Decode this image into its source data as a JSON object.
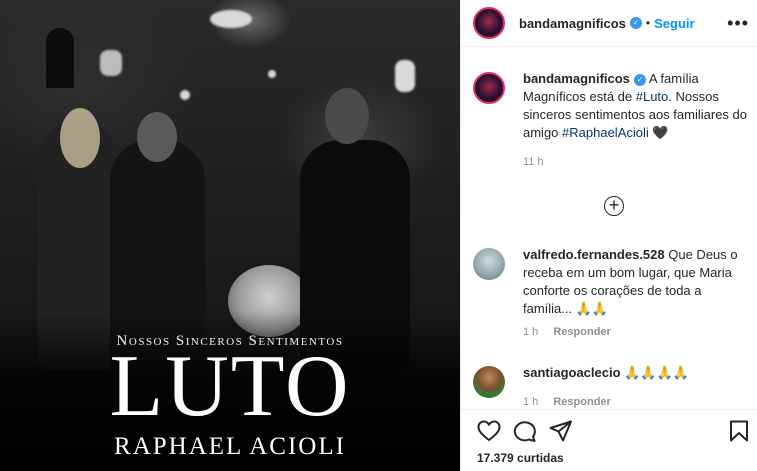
{
  "image": {
    "subtitle": "Nossos Sinceros Sentimentos",
    "title": "LUTO",
    "name": "RAPHAEL ACIOLI"
  },
  "header": {
    "username": "bandamagnificos",
    "separator": "•",
    "follow_label": "Seguir",
    "more_icon": "more-horizontal-icon"
  },
  "caption": {
    "username": "bandamagnificos",
    "text_1": "A família Magníficos está de ",
    "hashtag_1": "#Luto",
    "text_2": ". Nossos sinceros sentimentos aos familiares do amigo ",
    "hashtag_2": "#RaphaelAcioli",
    "emoji": "🖤",
    "time": "11 h"
  },
  "load_more_icon": "plus-circle-icon",
  "comments": [
    {
      "username": "valfredo.fernandes.528",
      "text": "Que Deus o receba em um bom lugar, que Maria conforte os corações de toda a família... 🙏🙏",
      "time": "1 h",
      "reply": "Responder"
    },
    {
      "username": "santiagoaclecio",
      "text": "🙏🙏🙏🙏",
      "time": "1 h",
      "reply": "Responder"
    }
  ],
  "actions": {
    "like_icon": "heart-icon",
    "comment_icon": "comment-icon",
    "share_icon": "share-icon",
    "save_icon": "bookmark-icon"
  },
  "likes": "17.379 curtidas",
  "colors": {
    "link": "#0095f6",
    "hashtag": "#00376b",
    "muted": "#8e8e8e",
    "verified": "#3897f0"
  }
}
